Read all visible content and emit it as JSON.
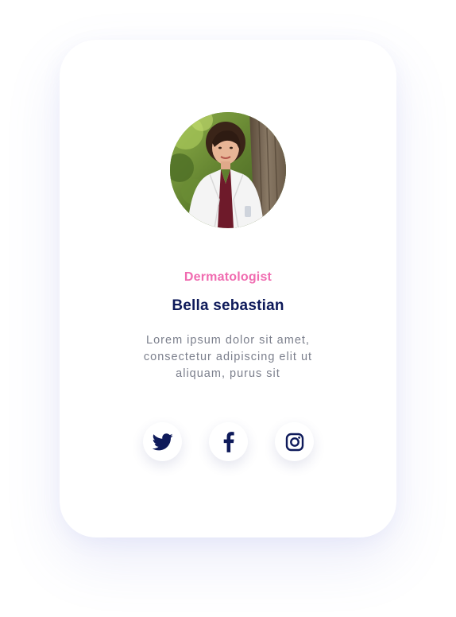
{
  "profile": {
    "role": "Dermatologist",
    "name": "Bella sebastian",
    "bio": "Lorem ipsum dolor sit amet, consectetur adipiscing elit ut aliquam, purus sit"
  },
  "socials": [
    {
      "icon": "twitter-icon"
    },
    {
      "icon": "facebook-icon"
    },
    {
      "icon": "instagram-icon"
    }
  ],
  "colors": {
    "accent_pink": "#f06bb0",
    "name_navy": "#0e1a5a",
    "icon_navy": "#0e1a5a",
    "bio_gray": "#7b7f8c",
    "card_bg": "#ffffff"
  }
}
